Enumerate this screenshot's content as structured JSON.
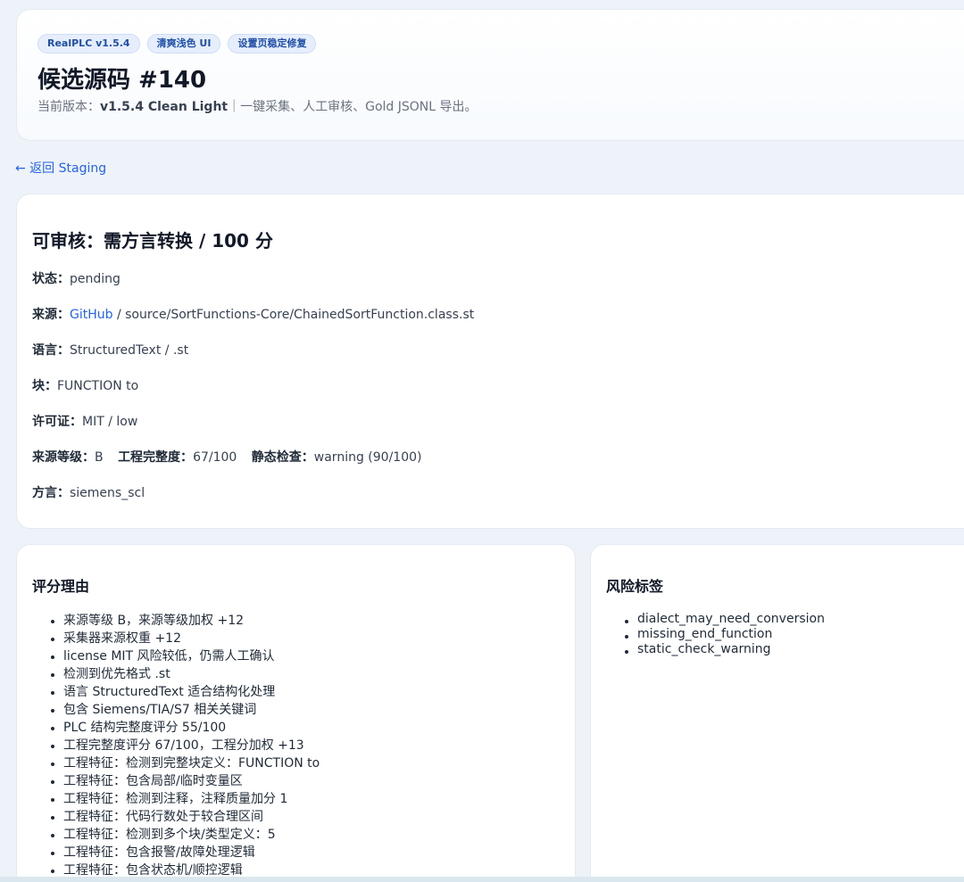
{
  "header": {
    "badges": [
      "RealPLC v1.5.4",
      "清爽浅色 UI",
      "设置页稳定修复"
    ],
    "title": "候选源码 #140",
    "subtitle_prefix": "当前版本：",
    "subtitle_version": "v1.5.4 Clean Light",
    "subtitle_suffix": "｜一键采集、人工审核、Gold JSONL 导出。"
  },
  "back_link": "← 返回 Staging",
  "info": {
    "title": "可审核：需方言转换 / 100 分",
    "status_label": "状态：",
    "status_value": "pending",
    "source_label": "来源：",
    "source_link": "GitHub",
    "source_path": " / source/SortFunctions-Core/ChainedSortFunction.class.st",
    "language_label": "语言：",
    "language_value": "StructuredText / .st",
    "block_label": "块：",
    "block_value": "FUNCTION to",
    "license_label": "许可证：",
    "license_value": "MIT / low",
    "grade_label": "来源等级：",
    "grade_value": "B",
    "completeness_label": "工程完整度：",
    "completeness_value": "67/100",
    "static_label": "静态检查：",
    "static_value": "warning (90/100)",
    "dialect_label": "方言：",
    "dialect_value": "siemens_scl"
  },
  "reasons": {
    "title": "评分理由",
    "items": [
      "来源等级 B，来源等级加权 +12",
      "采集器来源权重 +12",
      "license MIT 风险较低，仍需人工确认",
      "检测到优先格式 .st",
      "语言 StructuredText 适合结构化处理",
      "包含 Siemens/TIA/S7 相关关键词",
      "PLC 结构完整度评分 55/100",
      "工程完整度评分 67/100，工程分加权 +13",
      "工程特征：检测到完整块定义：FUNCTION to",
      "工程特征：包含局部/临时变量区",
      "工程特征：检测到注释，注释质量加分 1",
      "工程特征：代码行数处于较合理区间",
      "工程特征：检测到多个块/类型定义：5",
      "工程特征：包含报警/故障处理逻辑",
      "工程特征：包含状态机/顺控逻辑"
    ]
  },
  "risks": {
    "title": "风险标签",
    "items": [
      "dialect_may_need_conversion",
      "missing_end_function",
      "static_check_warning"
    ]
  }
}
